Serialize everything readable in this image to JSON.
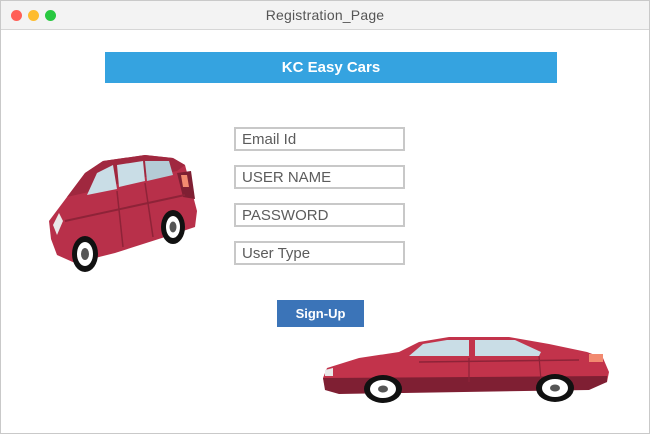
{
  "window": {
    "title": "Registration_Page"
  },
  "banner": {
    "title": "KC Easy Cars"
  },
  "form": {
    "email_placeholder": "Email Id",
    "username_placeholder": "USER NAME",
    "password_placeholder": "PASSWORD",
    "usertype_placeholder": "User Type",
    "signup_label": "Sign-Up"
  },
  "colors": {
    "banner": "#35a3e0",
    "button": "#3b74b8",
    "car_body": "#c0334a"
  },
  "icons": [
    "car-icon",
    "sedan-car-icon"
  ]
}
